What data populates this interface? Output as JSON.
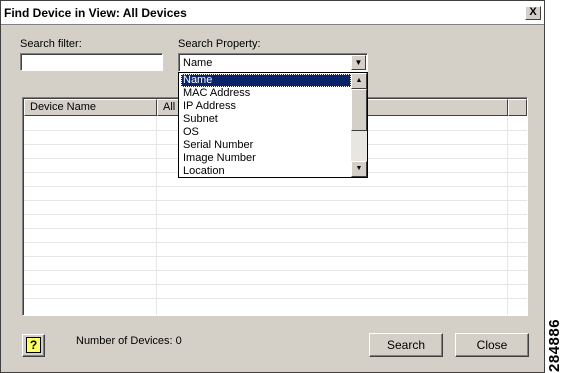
{
  "window": {
    "title": "Find Device in View: All Devices",
    "close_glyph": "X"
  },
  "search_filter": {
    "label": "Search filter:",
    "value": ""
  },
  "search_property": {
    "label": "Search Property:",
    "value": "Name",
    "options": [
      "Name",
      "MAC Address",
      "IP Address",
      "Subnet",
      "OS",
      "Serial Number",
      "Image Number",
      "Location"
    ],
    "selected_index": 0
  },
  "table": {
    "columns": [
      "Device Name",
      "All D"
    ],
    "rows": []
  },
  "status": {
    "device_count_text": "Number of Devices: 0"
  },
  "buttons": {
    "help_glyph": "?",
    "search": "Search",
    "close": "Close"
  },
  "figure_id": "284886",
  "colors": {
    "dialog_bg": "#d4d0c8",
    "selection_bg": "#0a246a"
  }
}
